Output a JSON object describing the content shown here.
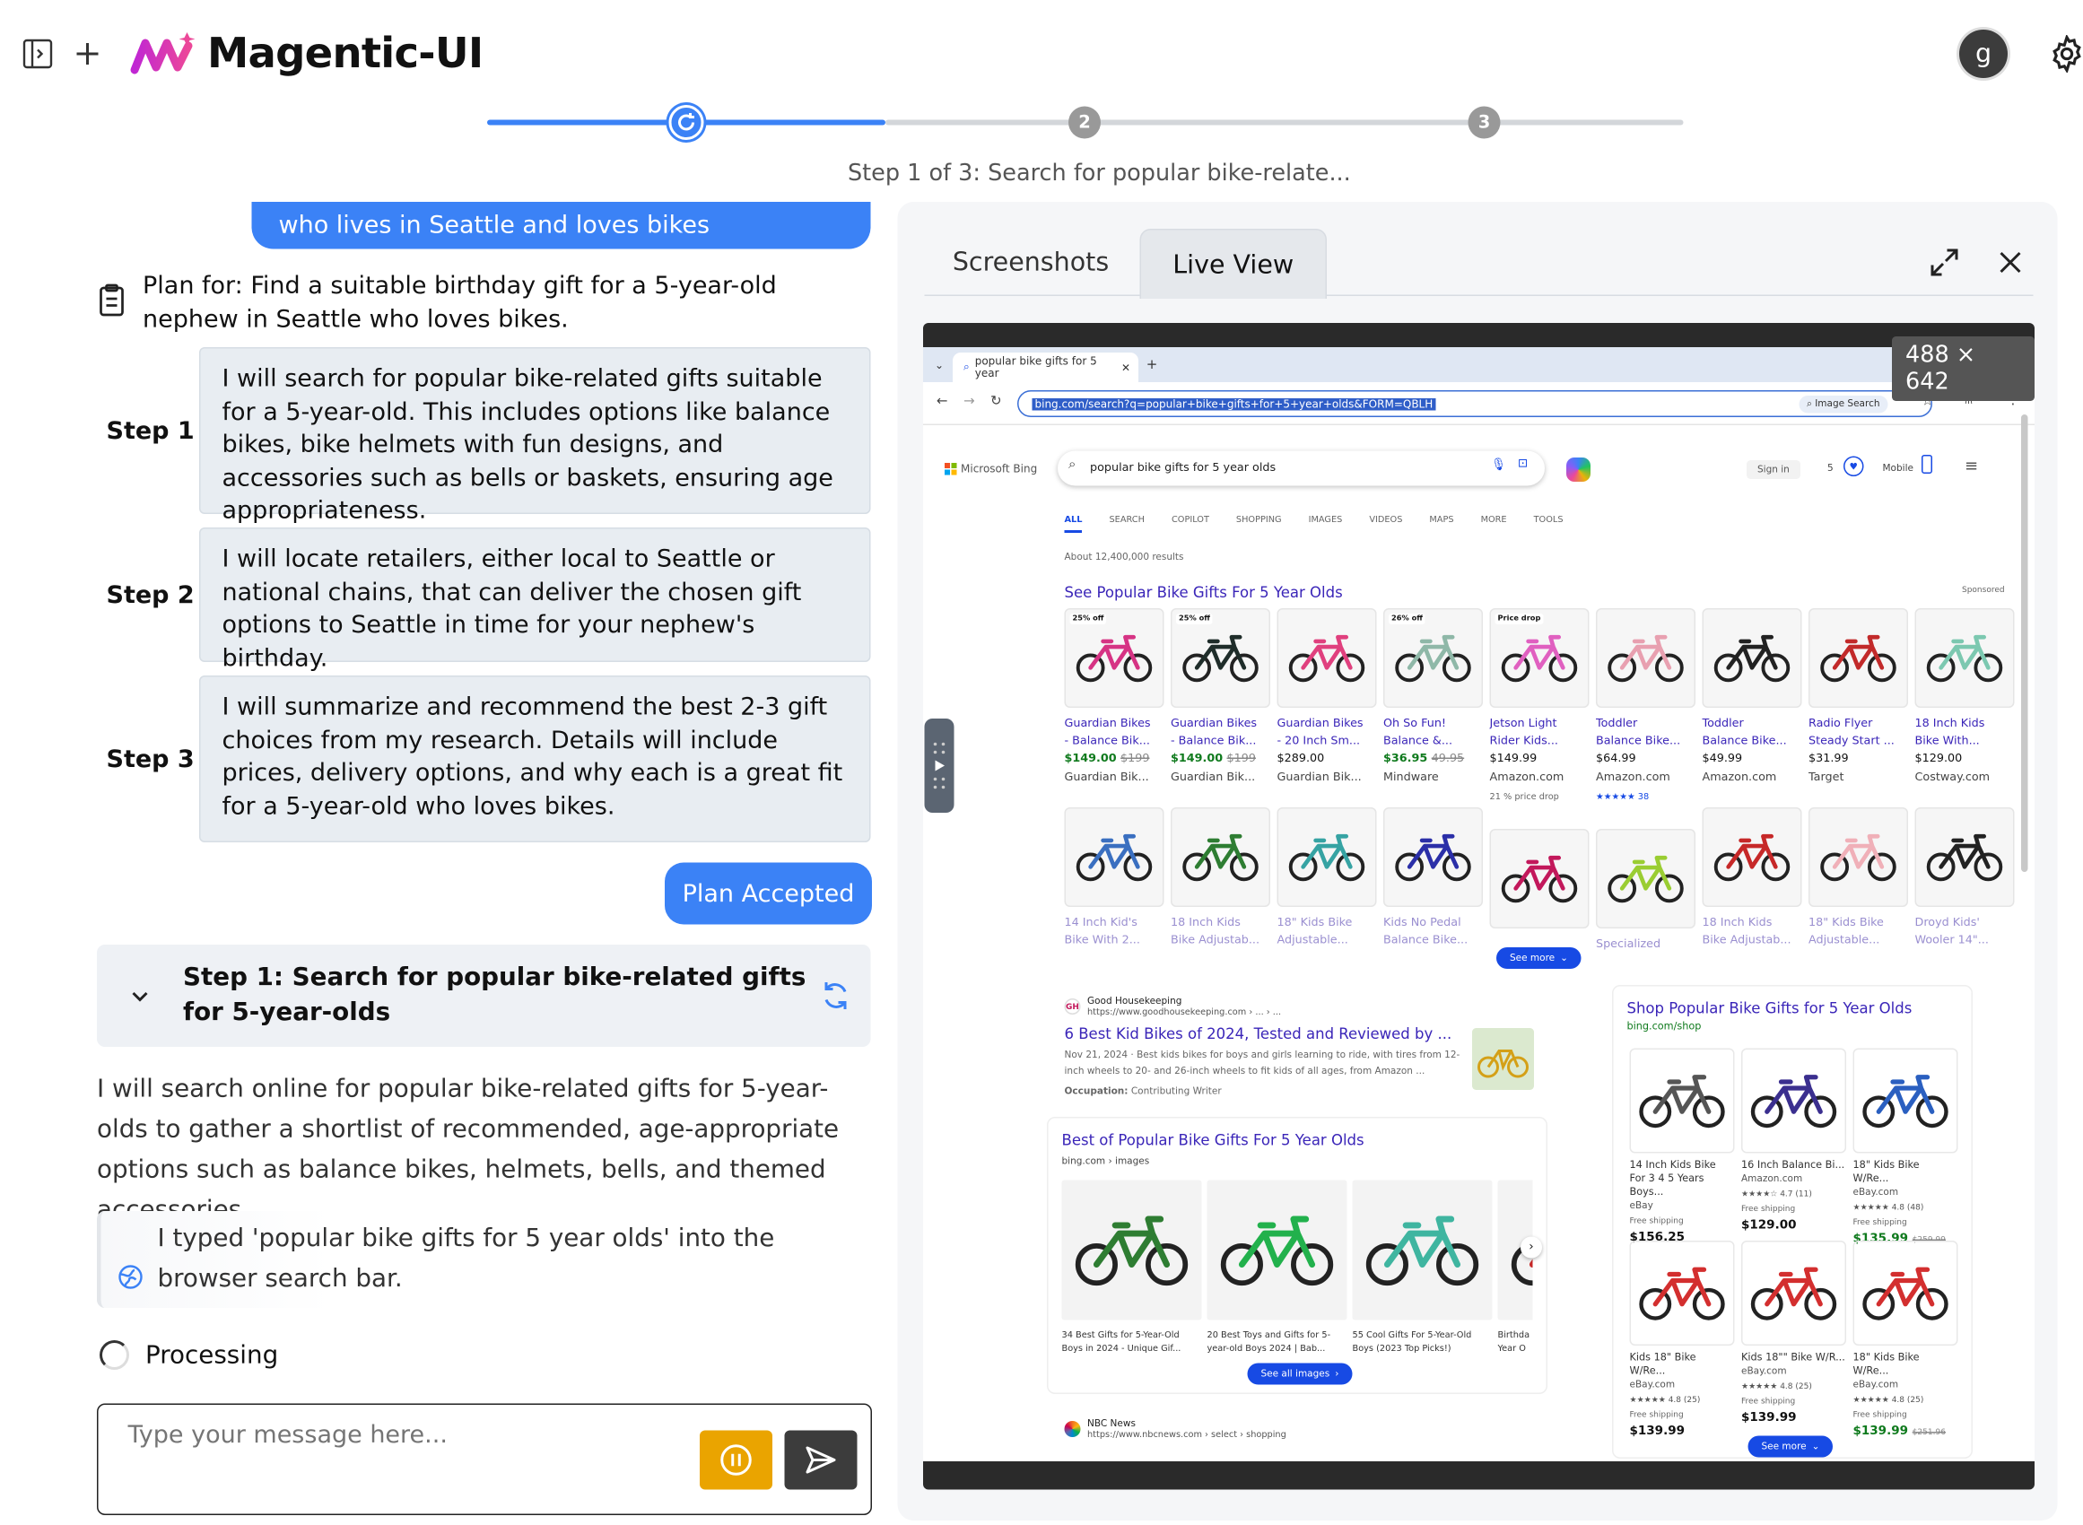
{
  "app": {
    "title": "Magentic-UI",
    "user_initial": "g"
  },
  "progress": {
    "caption": "Step 1 of 3: Search for popular bike-relate...",
    "steps": [
      "1",
      "2",
      "3"
    ],
    "current_step": 1
  },
  "chat": {
    "user_message_tail": "who lives in Seattle and loves bikes",
    "plan_for": "Plan for: Find a suitable birthday gift for a 5-year-old nephew in Seattle who loves bikes.",
    "steps": [
      {
        "label": "Step 1",
        "text": "I will search for popular bike-related gifts suitable for a 5-year-old. This includes options like balance bikes, bike helmets with fun designs, and accessories such as bells or baskets, ensuring age appropriateness."
      },
      {
        "label": "Step 2",
        "text": "I will locate retailers, either local to Seattle or national chains, that can deliver the chosen gift options to Seattle in time for your nephew's birthday."
      },
      {
        "label": "Step 3",
        "text": "I will summarize and recommend the best 2-3 gift choices from my research. Details will include prices, delivery options, and why each is a great fit for a 5-year-old who loves bikes."
      }
    ],
    "plan_accepted": "Plan Accepted",
    "current_step_title": "Step 1: Search for popular bike-related gifts for 5-year-olds",
    "step_description": "I will search online for popular bike-related gifts for 5-year-olds to gather a shortlist of recommended, age-appropriate options such as balance bikes, helmets, bells, and themed accessories.",
    "action_log": "I typed 'popular bike gifts for 5 year olds' into the browser search bar.",
    "status": "Processing",
    "input_placeholder": "Type your message here..."
  },
  "panel": {
    "tabs": [
      "Screenshots",
      "Live View"
    ],
    "active_tab": "Live View",
    "dimensions": "488 × 642"
  },
  "browser": {
    "tab_title": "popular bike gifts for 5 year",
    "url": "bing.com/search?q=popular+bike+gifts+for+5+year+olds&FORM=QBLH",
    "image_search": "Image Search",
    "bing_logo": "Microsoft Bing",
    "query": "popular bike gifts for 5 year olds",
    "sign_in": "Sign in",
    "rewards": "5",
    "mobile": "Mobile",
    "nav": [
      "ALL",
      "SEARCH",
      "COPILOT",
      "SHOPPING",
      "IMAGES",
      "VIDEOS",
      "MAPS",
      "MORE",
      "TOOLS"
    ],
    "results_count": "About 12,400,000 results",
    "products_title": "See Popular Bike Gifts For 5 Year Olds",
    "sponsored": "Sponsored",
    "products": [
      {
        "tag": "25% off",
        "name1": "Guardian Bikes",
        "name2": "- Balance Bik...",
        "price": "$149.00",
        "old": "$199",
        "store": "Guardian Bik...",
        "color": "#d63384"
      },
      {
        "tag": "25% off",
        "name1": "Guardian Bikes",
        "name2": "- Balance Bik...",
        "price": "$149.00",
        "old": "$199",
        "store": "Guardian Bik...",
        "color": "#1f2d2a"
      },
      {
        "tag": "",
        "name1": "Guardian Bikes",
        "name2": "- 20 Inch Sm...",
        "price": "$289.00",
        "old": "",
        "store": "Guardian Bik...",
        "color": "#e0407e"
      },
      {
        "tag": "26% off",
        "name1": "Oh So Fun!",
        "name2": "Balance &...",
        "price": "$36.95",
        "old": "49.95",
        "store": "Mindware",
        "color": "#8fb8a8"
      },
      {
        "tag": "Price drop",
        "name1": "Jetson Light",
        "name2": "Rider Kids...",
        "price": "$149.99",
        "old": "",
        "store": "Amazon.com",
        "extra": "21 % price drop",
        "color": "#e060c0"
      },
      {
        "tag": "",
        "name1": "Toddler",
        "name2": "Balance Bike...",
        "price": "$64.99",
        "old": "",
        "store": "Amazon.com",
        "extra": "★★★★★ 38",
        "color": "#e8a0b0"
      },
      {
        "tag": "",
        "name1": "Toddler",
        "name2": "Balance Bike...",
        "price": "$49.99",
        "old": "",
        "store": "Amazon.com",
        "color": "#222222"
      },
      {
        "tag": "",
        "name1": "Radio Flyer",
        "name2": "Steady Start ...",
        "price": "$31.99",
        "old": "",
        "store": "Target",
        "color": "#c22a2a"
      },
      {
        "tag": "",
        "name1": "18 Inch Kids",
        "name2": "Bike With...",
        "price": "$129.00",
        "old": "",
        "store": "Costway.com",
        "color": "#7cc8b0"
      }
    ],
    "products_row2": [
      {
        "name1": "14 Inch Kid's",
        "name2": "Bike With 2...",
        "color": "#3a6fc0"
      },
      {
        "name1": "18 Inch Kids",
        "name2": "Bike Adjustab...",
        "color": "#2e7d32"
      },
      {
        "name1": "18\" Kids Bike",
        "name2": "Adjustable...",
        "color": "#36a3a3"
      },
      {
        "name1": "Kids No Pedal",
        "name2": "Balance Bike...",
        "color": "#2b2fa8"
      },
      {
        "name1": "",
        "name2": "",
        "color": "#c2185b"
      },
      {
        "name1": "",
        "name2": "Specialized",
        "color": "#9acd32"
      },
      {
        "name1": "18 Inch Kids",
        "name2": "Bike Adjustab...",
        "color": "#c62828"
      },
      {
        "name1": "18\" Kids Bike",
        "name2": "Adjustable...",
        "color": "#f0b0b8"
      },
      {
        "name1": "Droyd Kids'",
        "name2": "Wooler 14\"...",
        "color": "#222222"
      }
    ],
    "see_more": "See more",
    "result1": {
      "site": "Good Housekeeping",
      "url": "https://www.goodhousekeeping.com › ... › ...",
      "title": "6 Best Kid Bikes of 2024, Tested and Reviewed by ...",
      "snippet1": "Nov 21, 2024 · Best kids bikes for boys and girls learning to ride, with tires from 12-",
      "snippet2": "inch wheels to 20- and 26-inch wheels to fit kids of all ages, from Amazon ...",
      "occupation_label": "Occupation:",
      "occupation": "Contributing Writer"
    },
    "images_block": {
      "title": "Best of Popular Bike Gifts For 5 Year Olds",
      "source": "bing.com › images",
      "items": [
        {
          "cap": "34 Best Gifts for 5-Year-Old Boys in 2024 - Unique Gif...",
          "color": "#2e7d32"
        },
        {
          "cap": "20 Best Toys and Gifts for 5-year-old Boys 2024 | Bab...",
          "color": "#22b14c"
        },
        {
          "cap": "55 Cool Gifts For 5-Year-Old Boys (2023 Top Picks!)",
          "color": "#3fb5a0"
        },
        {
          "cap": "Birthda Year O",
          "color": "#c62828"
        }
      ],
      "see_all": "See all images"
    },
    "shop": {
      "title": "Shop Popular Bike Gifts for 5 Year Olds",
      "source": "bing.com/shop",
      "items": [
        {
          "name": "14 Inch Kids Bike For 3 4 5 Years Boys...",
          "store": "eBay",
          "rating": "",
          "ship": "Free shipping",
          "price": "$156.25",
          "old": "",
          "color": "#555555"
        },
        {
          "name": "16 Inch Balance Bi...",
          "store": "Amazon.com",
          "rating": "★★★★☆ 4.7 (11)",
          "ship": "Free shipping",
          "price": "$129.00",
          "old": "",
          "color": "#3b2f8f"
        },
        {
          "name": "18\" Kids Bike W/Re...",
          "store": "eBay.com",
          "rating": "★★★★★ 4.8 (48)",
          "ship": "Free shipping",
          "price": "$135.99",
          "old": "$259.99",
          "color": "#2a5fc0"
        },
        {
          "name": "Kids 18\" Bike W/Re...",
          "store": "eBay.com",
          "rating": "★★★★★ 4.8 (25)",
          "ship": "Free shipping",
          "price": "$139.99",
          "old": "",
          "color": "#d32f2f"
        },
        {
          "name": "Kids 18\"\" Bike W/R...",
          "store": "eBay.com",
          "rating": "★★★★★ 4.8 (25)",
          "ship": "Free shipping",
          "price": "$139.99",
          "old": "",
          "color": "#d32f2f"
        },
        {
          "name": "18\" Kids Bike W/Re...",
          "store": "eBay.com",
          "rating": "★★★★★ 4.8 (25)",
          "ship": "Free shipping",
          "price": "$139.99",
          "old": "$251.96",
          "color": "#d32f2f"
        }
      ],
      "see_more": "See more"
    },
    "result2": {
      "site": "NBC News",
      "url": "https://www.nbcnews.com › select › shopping"
    }
  },
  "colors": {
    "accent": "#3b82f6",
    "pause": "#eaa400",
    "send": "#3c3c3c",
    "bing_link": "#3a25b8",
    "price_green": "#0f7a1d"
  }
}
